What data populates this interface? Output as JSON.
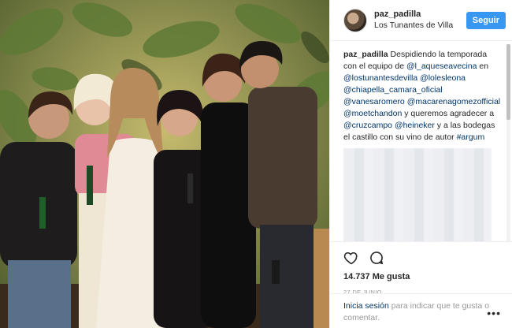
{
  "post": {
    "username": "paz_padilla",
    "location": "Los Tunantes de Villa",
    "follow_label": "Seguir"
  },
  "caption": {
    "user": "paz_padilla",
    "text_1": "Despidiendo la temporada con el equipo de ",
    "tag_1": "@l_aqueseavecina",
    "text_2": " en ",
    "tag_2": "@lostunantesdevilla",
    "text_3": " ",
    "tag_3": "@lolesleona",
    "text_4": " ",
    "tag_4": "@chiapella_camara_oficial",
    "text_5": " ",
    "tag_5": "@vanesaromero",
    "text_6": " ",
    "tag_6": "@macarenagomezofficial",
    "text_7": " ",
    "tag_7": "@moetchandon",
    "text_8": " y queremos agradecer a ",
    "tag_8": "@cruzcampo",
    "text_9": " ",
    "tag_9": "@heineker",
    "text_10": " y a las bodegas el castillo con su vino de autor ",
    "tag_10": "#argum"
  },
  "actions": {
    "like_icon": "heart-icon",
    "comment_icon": "comment-icon",
    "likes_text": "14.737 Me gusta",
    "date": "27 DE JUNIO"
  },
  "login": {
    "link": "Inicia sesión",
    "text": " para indicar que te gusta o comentar.",
    "more": "•••"
  },
  "colors": {
    "accent": "#3897f0",
    "link": "#003569",
    "muted": "#999999"
  }
}
